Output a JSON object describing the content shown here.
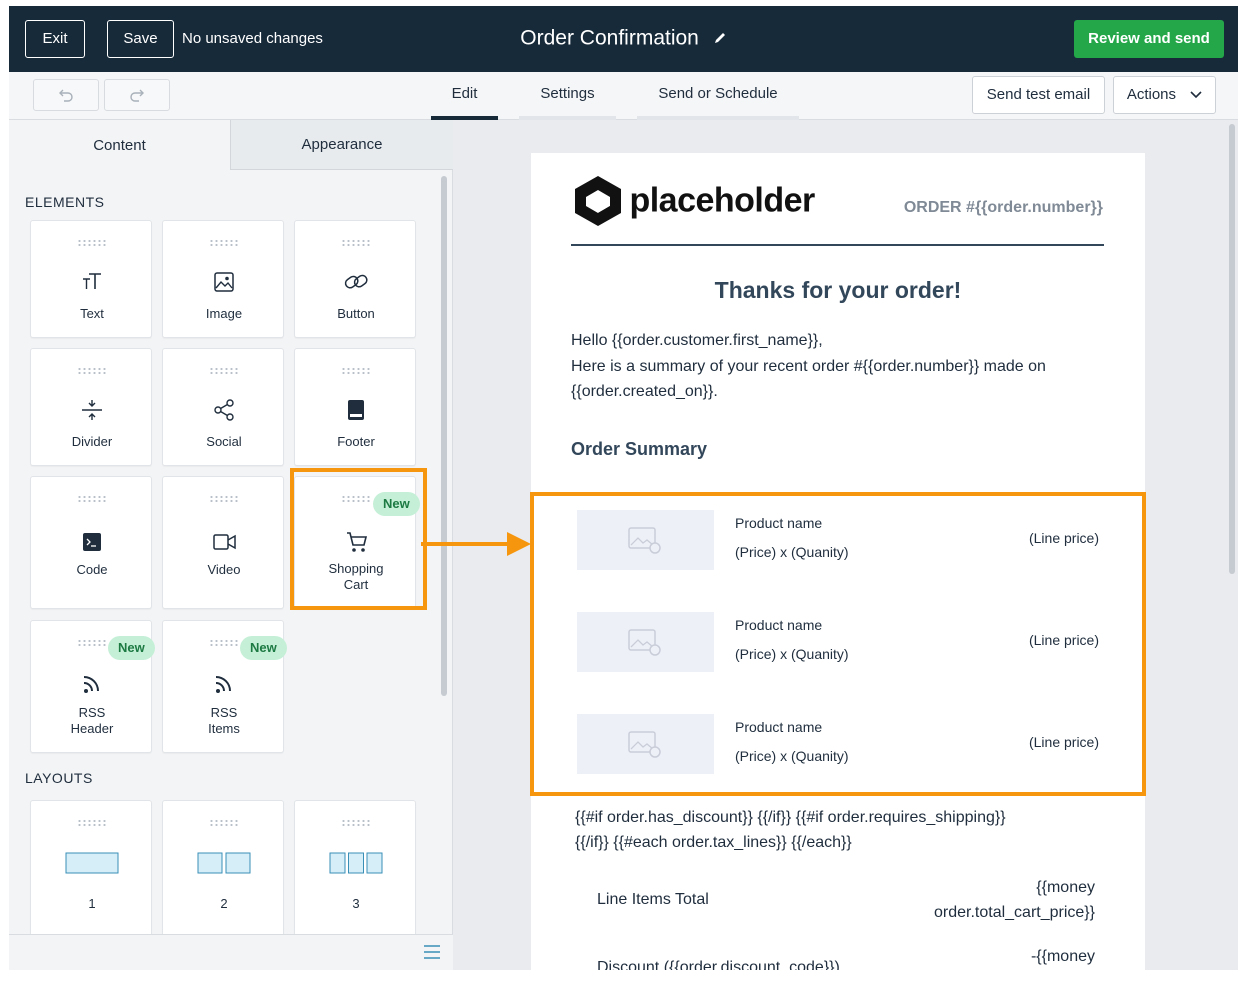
{
  "topbar": {
    "exit_label": "Exit",
    "save_label": "Save",
    "status_text": "No unsaved changes",
    "title": "Order Confirmation",
    "review_label": "Review and send",
    "bg_color": "#172a3a",
    "review_color": "#23a749"
  },
  "subbar": {
    "undo_icon": "undo-icon",
    "redo_icon": "redo-icon",
    "tabs": [
      {
        "label": "Edit",
        "active": true
      },
      {
        "label": "Settings",
        "active": false
      },
      {
        "label": "Send or Schedule",
        "active": false
      }
    ],
    "send_test_label": "Send test email",
    "actions_label": "Actions"
  },
  "panel": {
    "tabs": [
      {
        "label": "Content",
        "active": true
      },
      {
        "label": "Appearance",
        "active": false
      }
    ],
    "elements_heading": "ELEMENTS",
    "layouts_heading": "LAYOUTS",
    "elements": [
      {
        "label": "Text",
        "icon": "text-icon"
      },
      {
        "label": "Image",
        "icon": "image-icon"
      },
      {
        "label": "Button",
        "icon": "link-icon"
      },
      {
        "label": "Divider",
        "icon": "divider-icon"
      },
      {
        "label": "Social",
        "icon": "share-icon"
      },
      {
        "label": "Footer",
        "icon": "footer-icon"
      },
      {
        "label": "Code",
        "icon": "code-icon"
      },
      {
        "label": "Video",
        "icon": "video-icon"
      },
      {
        "label": "Shopping\nCart",
        "icon": "cart-icon",
        "badge": "New"
      },
      {
        "label": "RSS\nHeader",
        "icon": "rss-icon",
        "badge": "New"
      },
      {
        "label": "RSS\nItems",
        "icon": "rss-icon",
        "badge": "New"
      }
    ],
    "layouts": [
      {
        "label": "1"
      },
      {
        "label": "2"
      },
      {
        "label": "3"
      }
    ],
    "badge_color": "#c5f0d7"
  },
  "email": {
    "logo_text": "placeholder",
    "order_number": "ORDER #{{order.number}}",
    "heading": "Thanks for your order!",
    "greeting": "Hello {{order.customer.first_name}},",
    "summary_line_1": "Here is a summary of your recent order #{{order.number}} made on",
    "summary_line_2": "{{order.created_on}}.",
    "order_summary_heading": "Order Summary",
    "items": [
      {
        "name": "Product name",
        "qty": "(Price) x (Quanity)",
        "line_price": "(Line price)"
      },
      {
        "name": "Product name",
        "qty": "(Price) x (Quanity)",
        "line_price": "(Line price)"
      },
      {
        "name": "Product name",
        "qty": "(Price) x (Quanity)",
        "line_price": "(Line price)"
      }
    ],
    "logic_line_1": "{{#if order.has_discount}} {{/if}} {{#if order.requires_shipping}}",
    "logic_line_2": "{{/if}} {{#each order.tax_lines}} {{/each}}",
    "line_items_label": "Line Items Total",
    "line_items_value_1": "{{money",
    "line_items_value_2": "order.total_cart_price}}",
    "discount_label": "Discount ({{order.discount_code}})",
    "discount_value": "-{{money"
  },
  "annotation": {
    "highlight_color": "#f6960f"
  }
}
